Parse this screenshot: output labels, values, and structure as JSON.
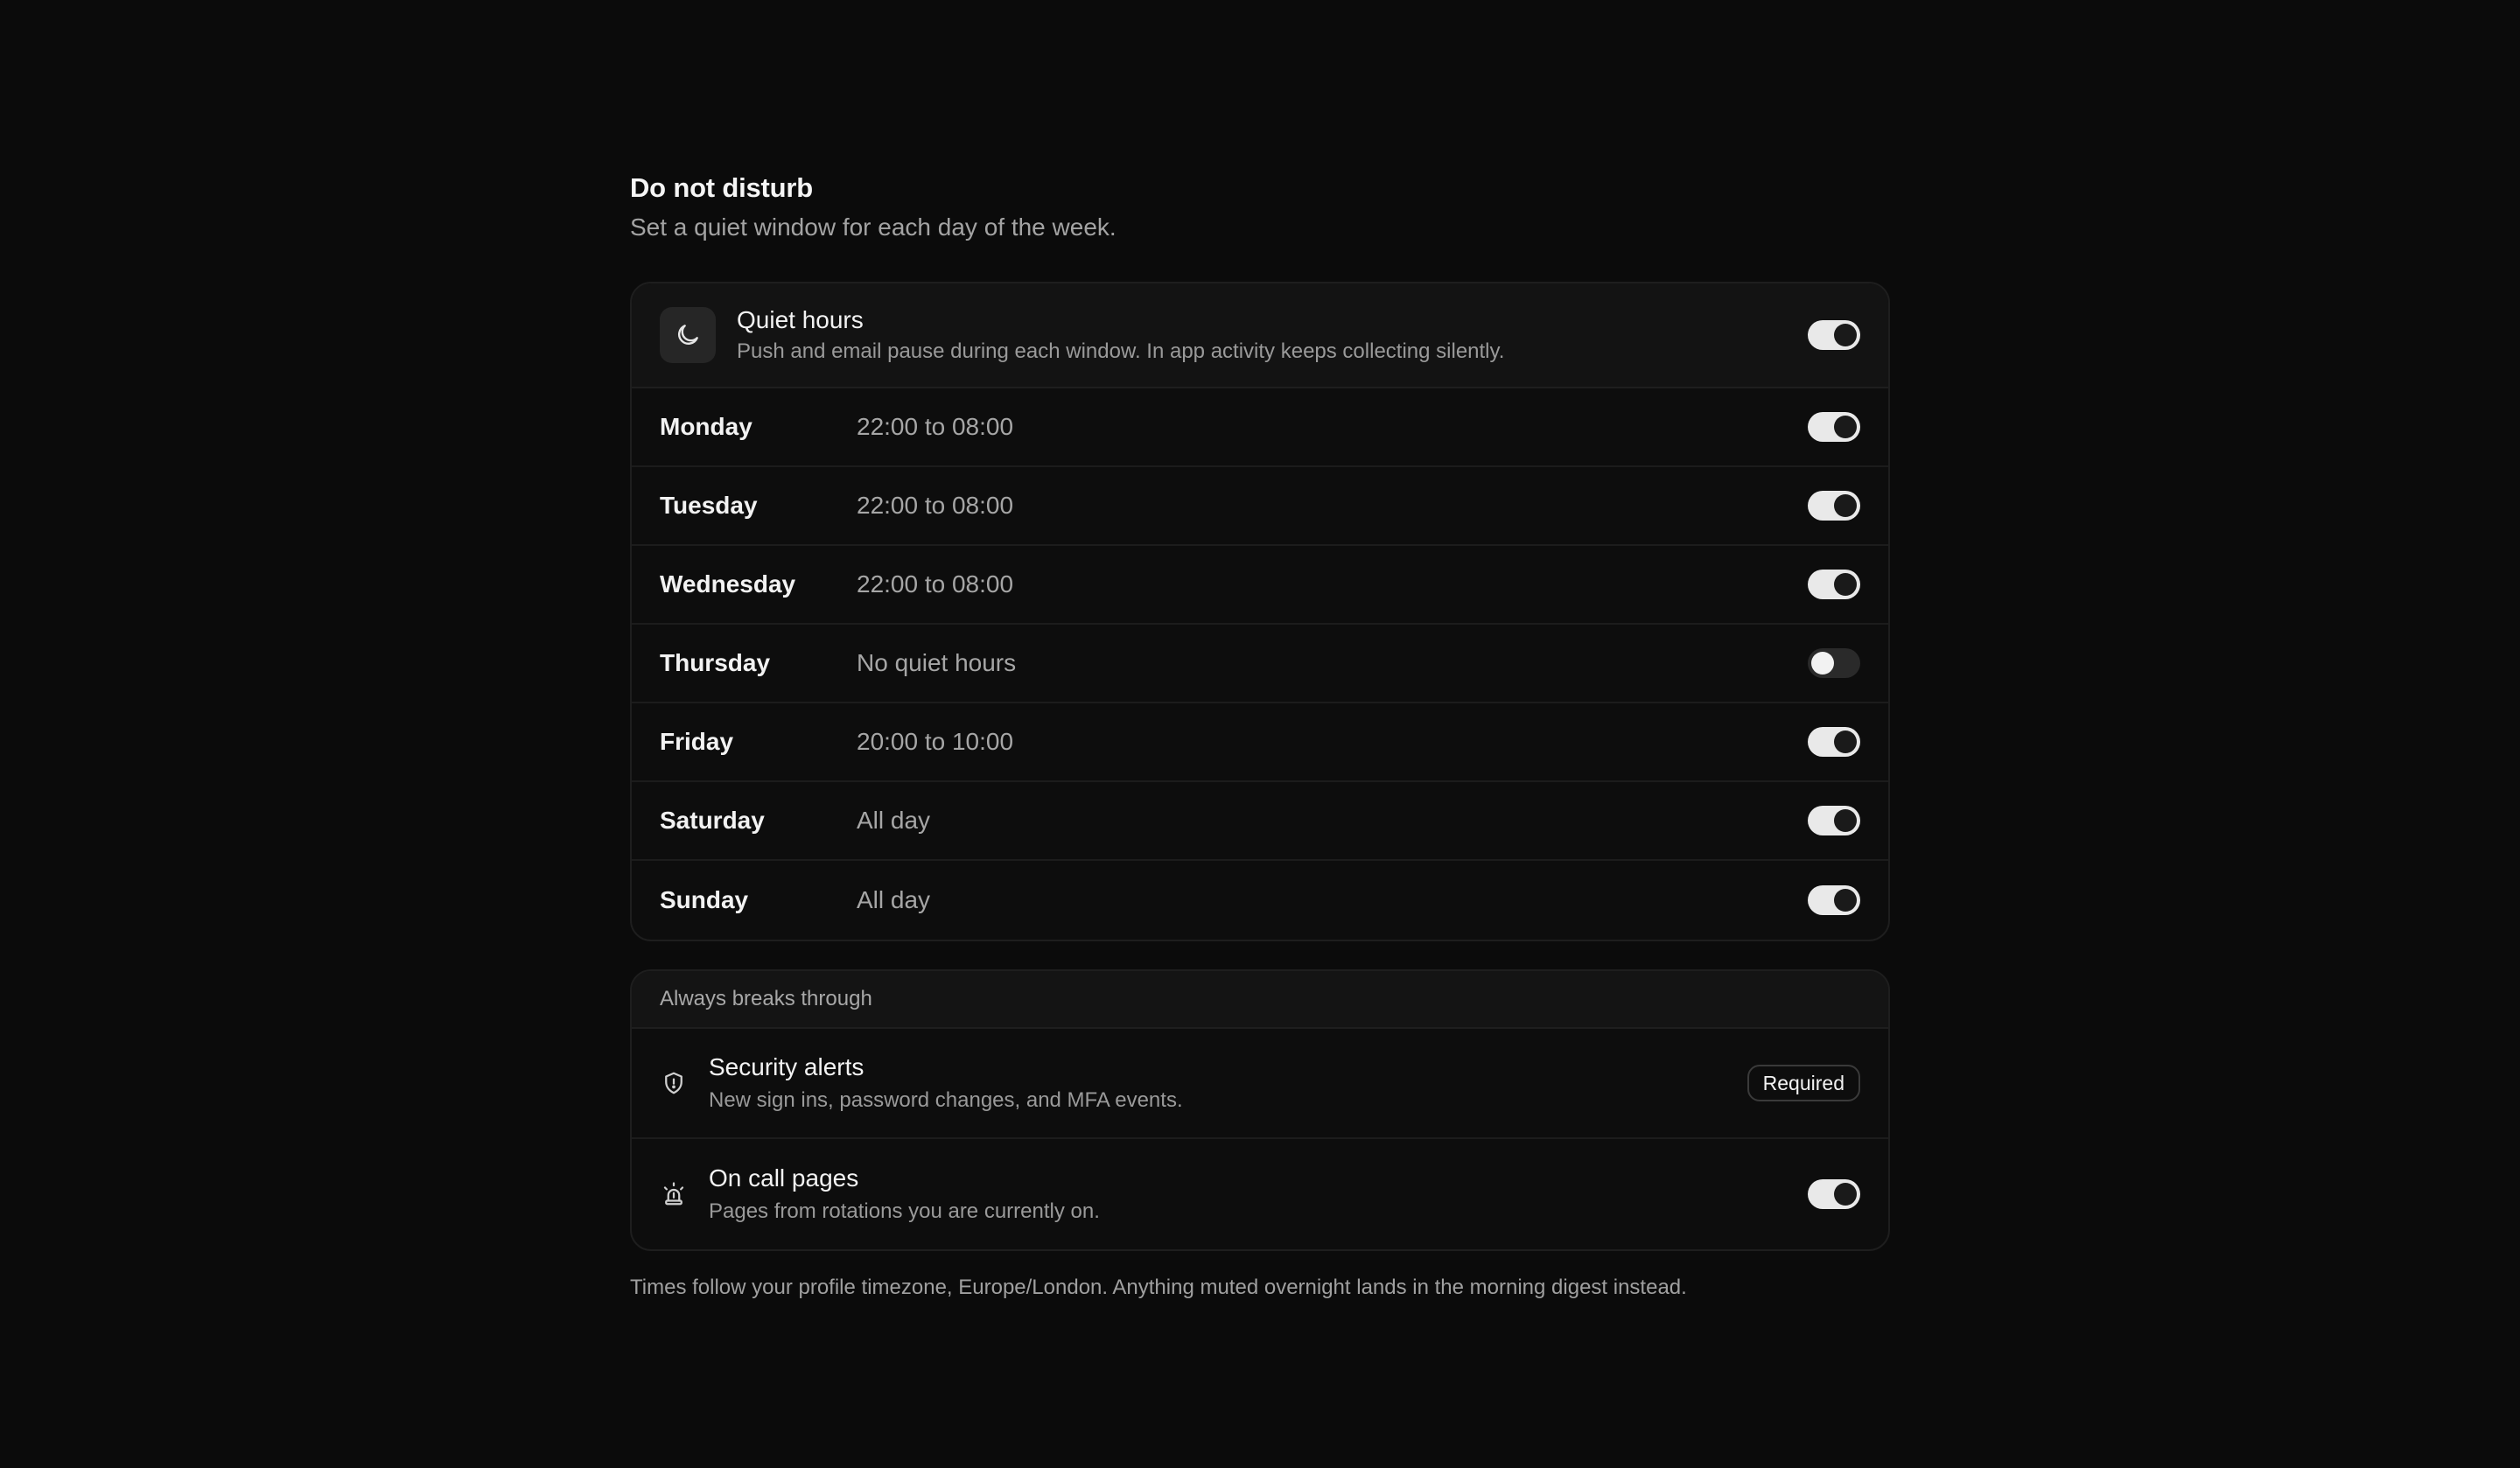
{
  "header": {
    "title": "Do not disturb",
    "subtitle": "Set a quiet window for each day of the week."
  },
  "quiet_hours": {
    "icon": "moon-icon",
    "title": "Quiet hours",
    "description": "Push and email pause during each window. In app activity keeps collecting silently.",
    "enabled": true
  },
  "days": [
    {
      "name": "Monday",
      "window": "22:00 to 08:00",
      "enabled": true
    },
    {
      "name": "Tuesday",
      "window": "22:00 to 08:00",
      "enabled": true
    },
    {
      "name": "Wednesday",
      "window": "22:00 to 08:00",
      "enabled": true
    },
    {
      "name": "Thursday",
      "window": "No quiet hours",
      "enabled": false
    },
    {
      "name": "Friday",
      "window": "20:00 to 10:00",
      "enabled": true
    },
    {
      "name": "Saturday",
      "window": "All day",
      "enabled": true
    },
    {
      "name": "Sunday",
      "window": "All day",
      "enabled": true
    }
  ],
  "breakthrough": {
    "header": "Always breaks through",
    "security": {
      "icon": "shield-icon",
      "title": "Security alerts",
      "description": "New sign ins, password changes, and MFA events.",
      "badge": "Required"
    },
    "oncall": {
      "icon": "siren-icon",
      "title": "On call pages",
      "description": "Pages from rotations you are currently on.",
      "enabled": true
    }
  },
  "footnote": "Times follow your profile timezone, Europe/London. Anything muted overnight lands in the morning digest instead.",
  "colors": {
    "background": "#0b0b0b",
    "toggle_on": "#e9e9e9",
    "toggle_off": "#2a2a2a"
  }
}
